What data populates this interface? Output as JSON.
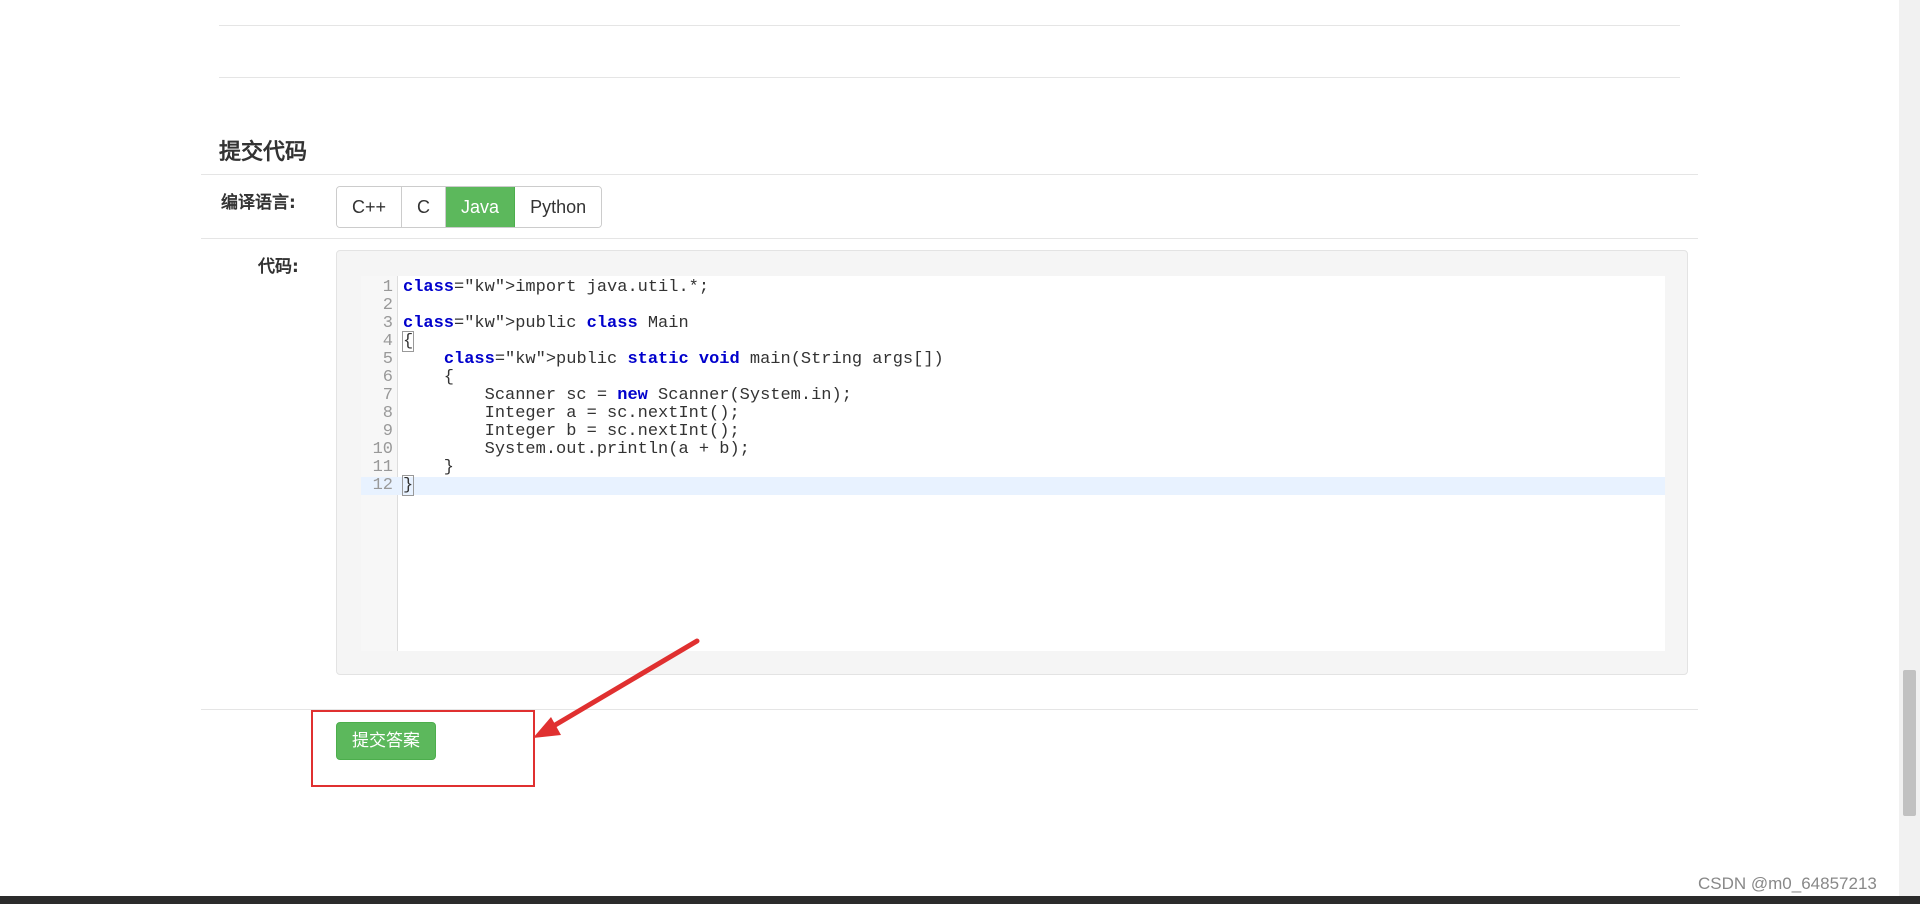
{
  "section_title": "提交代码",
  "language_label": "编译语言:",
  "languages": [
    {
      "label": "C++",
      "active": false
    },
    {
      "label": "C",
      "active": false
    },
    {
      "label": "Java",
      "active": true
    },
    {
      "label": "Python",
      "active": false
    }
  ],
  "code_label": "代码:",
  "code_lines": [
    "import java.util.*;",
    "",
    "public class Main",
    "{",
    "    public static void main(String args[])",
    "    {",
    "        Scanner sc = new Scanner(System.in);",
    "        Integer a = sc.nextInt();",
    "        Integer b = sc.nextInt();",
    "        System.out.println(a + b);",
    "    }",
    "}"
  ],
  "active_line": 12,
  "submit_label": "提交答案",
  "watermark": "CSDN @m0_64857213",
  "colors": {
    "accent_green": "#5cb85c",
    "annotation_red": "#e03030",
    "keyword_blue": "#0000cc"
  }
}
